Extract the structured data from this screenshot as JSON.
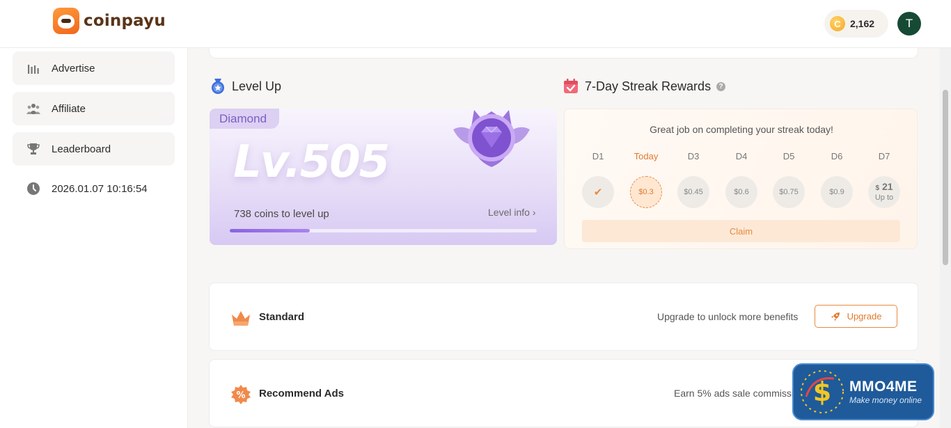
{
  "header": {
    "logo_text": "coinpayu",
    "coin_balance": "2,162",
    "coin_symbol": "C",
    "avatar_initial": "T"
  },
  "sidebar": {
    "items": [
      {
        "label": "Advertise",
        "icon": "bar-chart-icon"
      },
      {
        "label": "Affiliate",
        "icon": "people-icon"
      },
      {
        "label": "Leaderboard",
        "icon": "trophy-icon"
      },
      {
        "label": "2026.01.07 10:16:54",
        "icon": "clock-icon"
      }
    ]
  },
  "level": {
    "title": "Level Up",
    "tier": "Diamond",
    "level_text": "Lv.505",
    "coins_to_level": "738 coins to level up",
    "level_info": "Level info ›",
    "progress_fraction": 0.26
  },
  "streak": {
    "title": "7-Day Streak Rewards",
    "help": "?",
    "message": "Great job on completing your streak today!",
    "days": [
      {
        "label": "D1",
        "reward": "✔"
      },
      {
        "label": "Today",
        "reward": "$0.3"
      },
      {
        "label": "D3",
        "reward": "$0.45"
      },
      {
        "label": "D4",
        "reward": "$0.6"
      },
      {
        "label": "D5",
        "reward": "$0.75"
      },
      {
        "label": "D6",
        "reward": "$0.9"
      },
      {
        "label": "D7",
        "reward_currency": "$",
        "reward_big": "21",
        "reward_sub": "Up to"
      }
    ],
    "claim_label": "Claim"
  },
  "membership": {
    "label": "Standard",
    "hint": "Upgrade to unlock more benefits",
    "button_label": "Upgrade"
  },
  "recommend": {
    "label": "Recommend Ads",
    "hint": "Earn 5% ads sale commission"
  },
  "watermark": {
    "brand": "MMO4ME",
    "tagline": "Make money online"
  },
  "colors": {
    "accent": "#e07a2e",
    "purple": "#8b63e0",
    "avatar_bg": "#174a34"
  }
}
